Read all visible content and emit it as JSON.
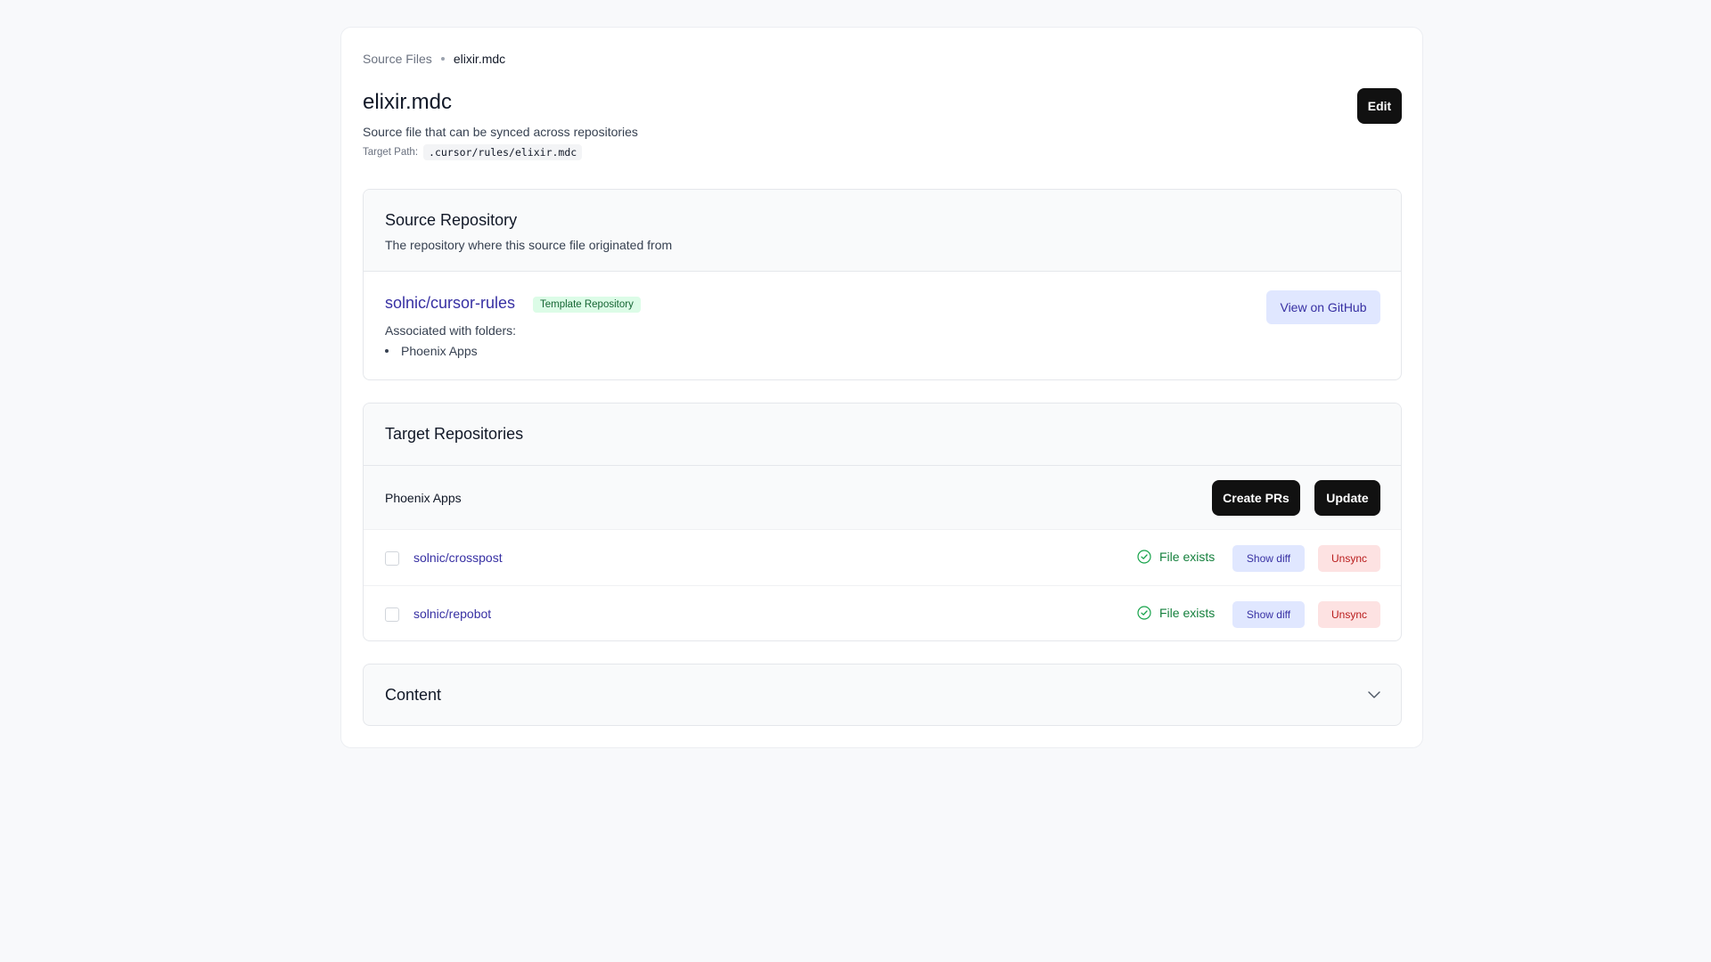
{
  "breadcrumb": {
    "parent": "Source Files",
    "current": "elixir.mdc"
  },
  "header": {
    "title": "elixir.mdc",
    "description": "Source file that can be synced across repositories",
    "target_path_label": "Target Path:",
    "target_path": ".cursor/rules/elixir.mdc",
    "edit_label": "Edit"
  },
  "source_repo": {
    "title": "Source Repository",
    "subtitle": "The repository where this source file originated from",
    "repo_name": "solnic/cursor-rules",
    "badge": "Template Repository",
    "assoc_label": "Associated with folders:",
    "folders": [
      "Phoenix Apps"
    ],
    "github_label": "View on GitHub"
  },
  "target_repos": {
    "title": "Target Repositories",
    "group": {
      "name": "Phoenix Apps",
      "create_prs_label": "Create PRs",
      "update_label": "Update"
    },
    "rows": [
      {
        "repo": "solnic/crosspost",
        "status": "File exists",
        "diff_label": "Show diff",
        "unsync_label": "Unsync"
      },
      {
        "repo": "solnic/repobot",
        "status": "File exists",
        "diff_label": "Show diff",
        "unsync_label": "Unsync"
      }
    ]
  },
  "content": {
    "title": "Content",
    "icon": "chevron-down-icon"
  },
  "colors": {
    "accent": "#3730a3",
    "success": "#15803d",
    "danger": "#b91c1c",
    "dark_button": "#111111"
  }
}
